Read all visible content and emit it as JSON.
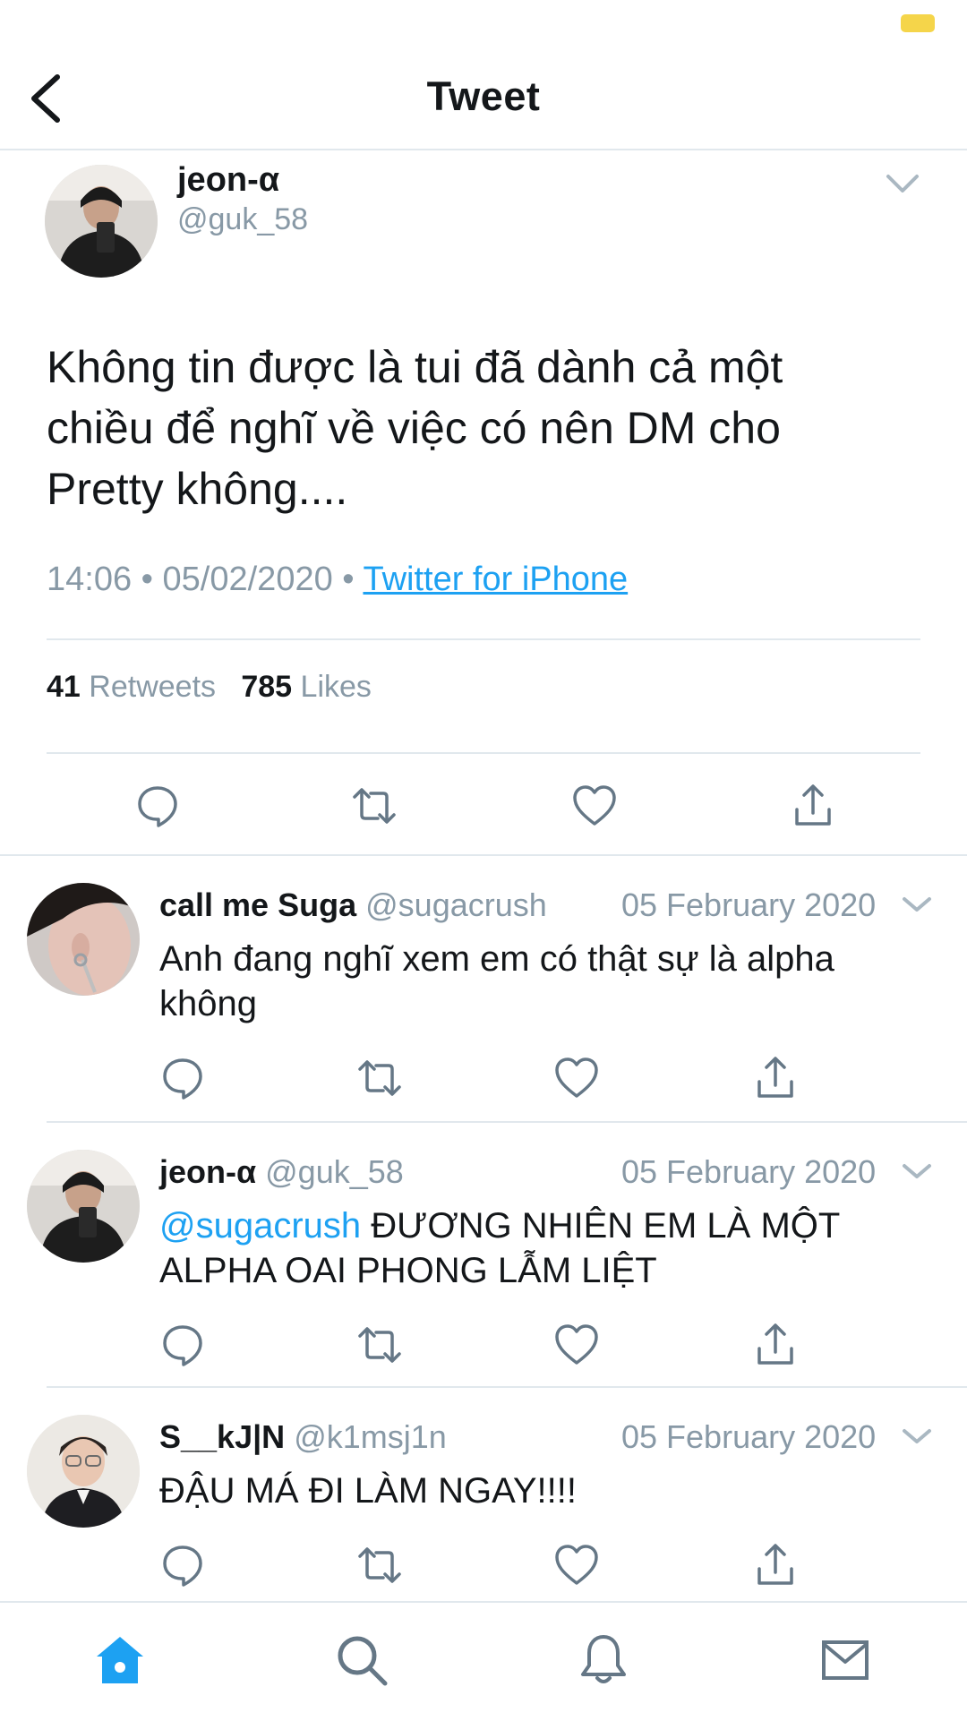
{
  "header": {
    "title": "Tweet"
  },
  "main_tweet": {
    "name": "jeon-α",
    "handle": "@guk_58",
    "text_line1": "Không tin được là tui đã dành cả một",
    "text_line2": "chiều để nghĩ về việc có nên DM cho",
    "text_line3": "Pretty không....",
    "time": "14:06",
    "date": "05/02/2020",
    "separator": "•",
    "source": "Twitter for iPhone",
    "retweets_count": "41",
    "retweets_label": "Retweets",
    "likes_count": "785",
    "likes_label": "Likes"
  },
  "replies": [
    {
      "name": "call me Suga",
      "handle": "@sugacrush",
      "date": "05 February 2020",
      "line1": "Anh đang nghĩ xem em có thật sự là alpha",
      "line2": "không"
    },
    {
      "name": "jeon-α",
      "handle": "@guk_58",
      "date": "05 February 2020",
      "mention": "@sugacrush",
      "line1": " ĐƯƠNG NHIÊN EM LÀ MỘT",
      "line2": "ALPHA OAI PHONG LẪM LIỆT"
    },
    {
      "name": "S__kJ|N",
      "handle": "@k1msj1n",
      "date": "05 February 2020",
      "line1": "ĐẬU MÁ ĐI LÀM NGAY!!!!"
    }
  ],
  "icons": {
    "reply": "speech-bubble-icon",
    "retweet": "retweet-icon",
    "like": "heart-icon",
    "share": "share-icon",
    "home": "home-icon",
    "search": "search-icon",
    "notifications": "bell-icon",
    "messages": "mail-icon"
  },
  "colors": {
    "accent": "#1da1f2",
    "muted": "#8899a6",
    "battery": "#f5d54a"
  }
}
